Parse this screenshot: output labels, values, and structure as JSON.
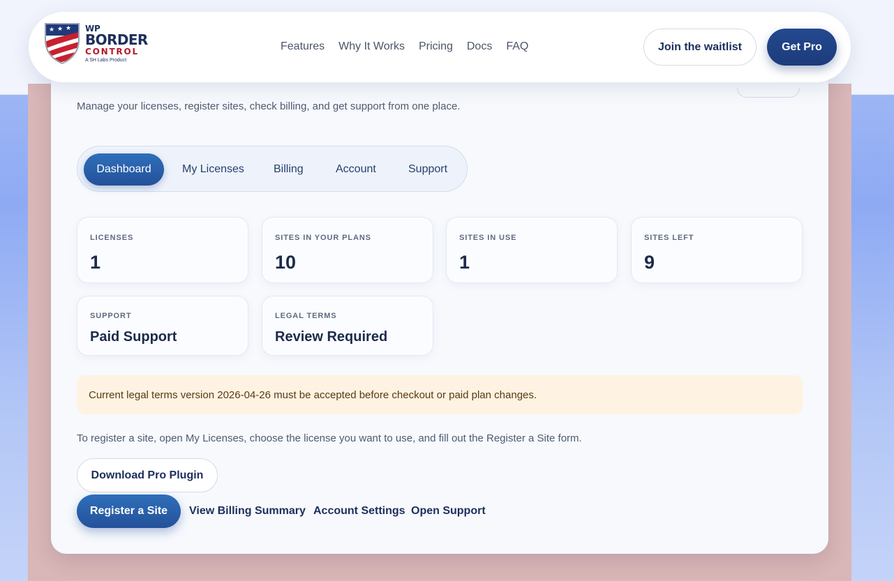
{
  "brand": {
    "line1": "WP",
    "line2": "BORDER",
    "line3": "CONTROL",
    "tagline": "A SH Labs Product"
  },
  "nav": {
    "links": [
      "Features",
      "Why It Works",
      "Pricing",
      "Docs",
      "FAQ"
    ],
    "waitlist_label": "Join the waitlist",
    "getpro_label": "Get Pro"
  },
  "page": {
    "subtitle": "Manage your licenses, register sites, check billing, and get support from one place."
  },
  "tabs": [
    {
      "label": "Dashboard",
      "active": true
    },
    {
      "label": "My Licenses",
      "active": false
    },
    {
      "label": "Billing",
      "active": false
    },
    {
      "label": "Account",
      "active": false
    },
    {
      "label": "Support",
      "active": false
    }
  ],
  "stats": [
    {
      "label": "LICENSES",
      "value": "1"
    },
    {
      "label": "SITES IN YOUR PLANS",
      "value": "10"
    },
    {
      "label": "SITES IN USE",
      "value": "1"
    },
    {
      "label": "SITES LEFT",
      "value": "9"
    },
    {
      "label": "SUPPORT",
      "value": "Paid Support"
    },
    {
      "label": "LEGAL TERMS",
      "value": "Review Required"
    }
  ],
  "alert": {
    "text": "Current legal terms version 2026-04-26 must be accepted before checkout or paid plan changes."
  },
  "register_note": "To register a site, open My Licenses, choose the license you want to use, and fill out the Register a Site form.",
  "actions": {
    "download_label": "Download Pro Plugin",
    "register_label": "Register a Site",
    "billing_label": "View Billing Summary",
    "account_label": "Account Settings",
    "support_label": "Open Support"
  },
  "colors": {
    "primary": "#24519a",
    "navy": "#1c2f5c",
    "accent_red": "#b11a2c",
    "alert_bg": "#fef2e2"
  }
}
